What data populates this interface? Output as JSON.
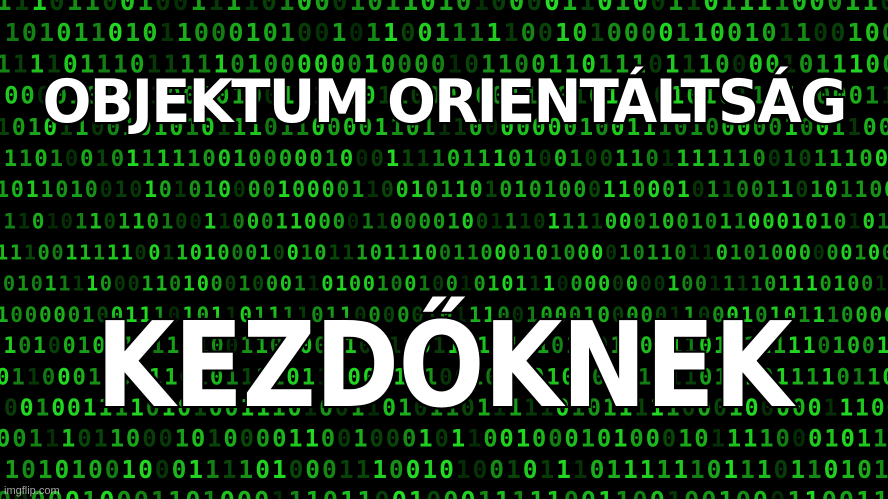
{
  "meme": {
    "top_text": "OBJEKTUM ORIENTÁLTSÁG",
    "bottom_text": "KEZDŐKNEK",
    "watermark": "imgflip.com"
  },
  "background": {
    "content": "binary digits",
    "digit_color": "#22dd22",
    "dim_digit_color": "#0a4a0a",
    "base_color": "#000000"
  },
  "colors": {
    "caption_fill": "#ffffff",
    "caption_outline": "#000000"
  }
}
